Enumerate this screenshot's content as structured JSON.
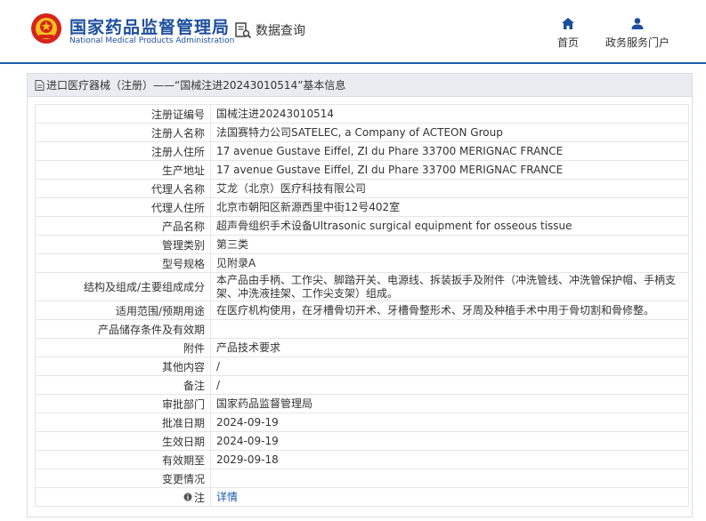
{
  "header": {
    "brand_cn": "国家药品监督管理局",
    "brand_en": "National Medical Products Administration",
    "search_label": "数据查询",
    "nav": [
      {
        "label": "首页",
        "icon": "home-icon"
      },
      {
        "label": "政务服务门户",
        "icon": "user-icon"
      }
    ]
  },
  "card": {
    "title": "进口医疗器械（注册）——“国械注进20243010514”基本信息"
  },
  "rows": [
    {
      "label": "注册证编号",
      "value": "国械注进20243010514"
    },
    {
      "label": "注册人名称",
      "value": "法国赛特力公司SATELEC, a Company of ACTEON Group"
    },
    {
      "label": "注册人住所",
      "value": "17 avenue Gustave Eiffel, ZI du Phare 33700 MERIGNAC FRANCE"
    },
    {
      "label": "生产地址",
      "value": "17 avenue Gustave Eiffel, ZI du Phare 33700 MERIGNAC FRANCE"
    },
    {
      "label": "代理人名称",
      "value": "艾龙（北京）医疗科技有限公司"
    },
    {
      "label": "代理人住所",
      "value": "北京市朝阳区新源西里中街12号402室"
    },
    {
      "label": "产品名称",
      "value": "超声骨组织手术设备Ultrasonic surgical equipment for osseous tissue"
    },
    {
      "label": "管理类别",
      "value": "第三类"
    },
    {
      "label": "型号规格",
      "value": "见附录A"
    },
    {
      "label": "结构及组成/主要组成成分",
      "value": "本产品由手柄、工作尖、脚踏开关、电源线、拆装扳手及附件（冲洗管线、冲洗管保护帽、手柄支架、冲洗液挂架、工作尖支架）组成。"
    },
    {
      "label": "适用范围/预期用途",
      "value": "在医疗机构使用，在牙槽骨切开术、牙槽骨整形术、牙周及种植手术中用于骨切割和骨修整。"
    },
    {
      "label": "产品储存条件及有效期",
      "value": ""
    },
    {
      "label": "附件",
      "value": "产品技术要求"
    },
    {
      "label": "其他内容",
      "value": "/"
    },
    {
      "label": "备注",
      "value": "/"
    },
    {
      "label": "审批部门",
      "value": "国家药品监督管理局"
    },
    {
      "label": "批准日期",
      "value": "2024-09-19"
    },
    {
      "label": "生效日期",
      "value": "2024-09-19"
    },
    {
      "label": "有效期至",
      "value": "2029-09-18"
    },
    {
      "label": "变更情况",
      "value": ""
    }
  ],
  "note_row": {
    "label": "注",
    "link": "详情",
    "icon": "info-icon"
  },
  "colors": {
    "brand": "#1d4e9e",
    "link": "#1a5aa8",
    "header_border": "#1a5aa8"
  }
}
